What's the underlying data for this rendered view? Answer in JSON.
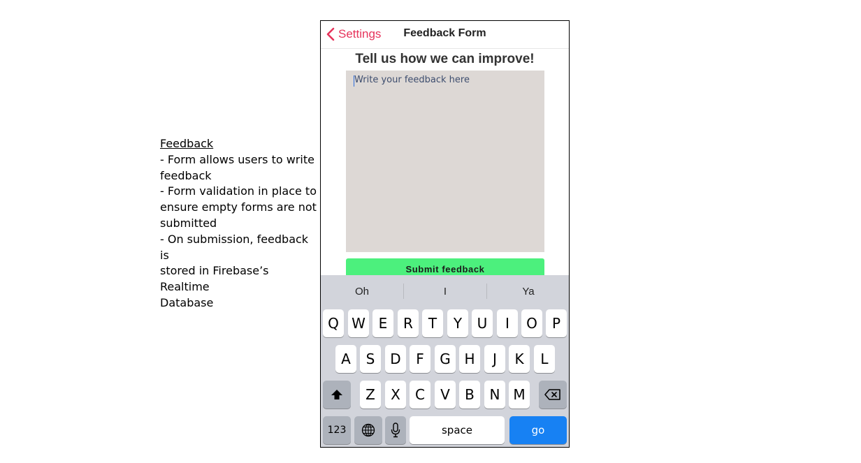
{
  "notes": {
    "heading": "Feedback",
    "lines": [
      "- Form allows users to write",
      "feedback",
      "- Form validation in place to",
      "ensure empty forms are not",
      "submitted",
      "- On submission, feedback is",
      "stored in Firebase’s Realtime",
      "Database"
    ]
  },
  "nav": {
    "back_label": "Settings",
    "title": "Feedback Form"
  },
  "form": {
    "headline": "Tell us how we can improve!",
    "placeholder": "Write your feedback here",
    "submit_label": "Submit feedback"
  },
  "keyboard": {
    "suggestions": [
      "Oh",
      "I",
      "Ya"
    ],
    "row1": [
      "Q",
      "W",
      "E",
      "R",
      "T",
      "Y",
      "U",
      "I",
      "O",
      "P"
    ],
    "row2": [
      "A",
      "S",
      "D",
      "F",
      "G",
      "H",
      "J",
      "K",
      "L"
    ],
    "row3": [
      "Z",
      "X",
      "C",
      "V",
      "B",
      "N",
      "M"
    ],
    "numbers_label": "123",
    "space_label": "space",
    "go_label": "go"
  },
  "colors": {
    "accent": "#e6335b",
    "submit": "#4cf07d",
    "go": "#1781f3",
    "textarea": "#ddd8d5"
  }
}
